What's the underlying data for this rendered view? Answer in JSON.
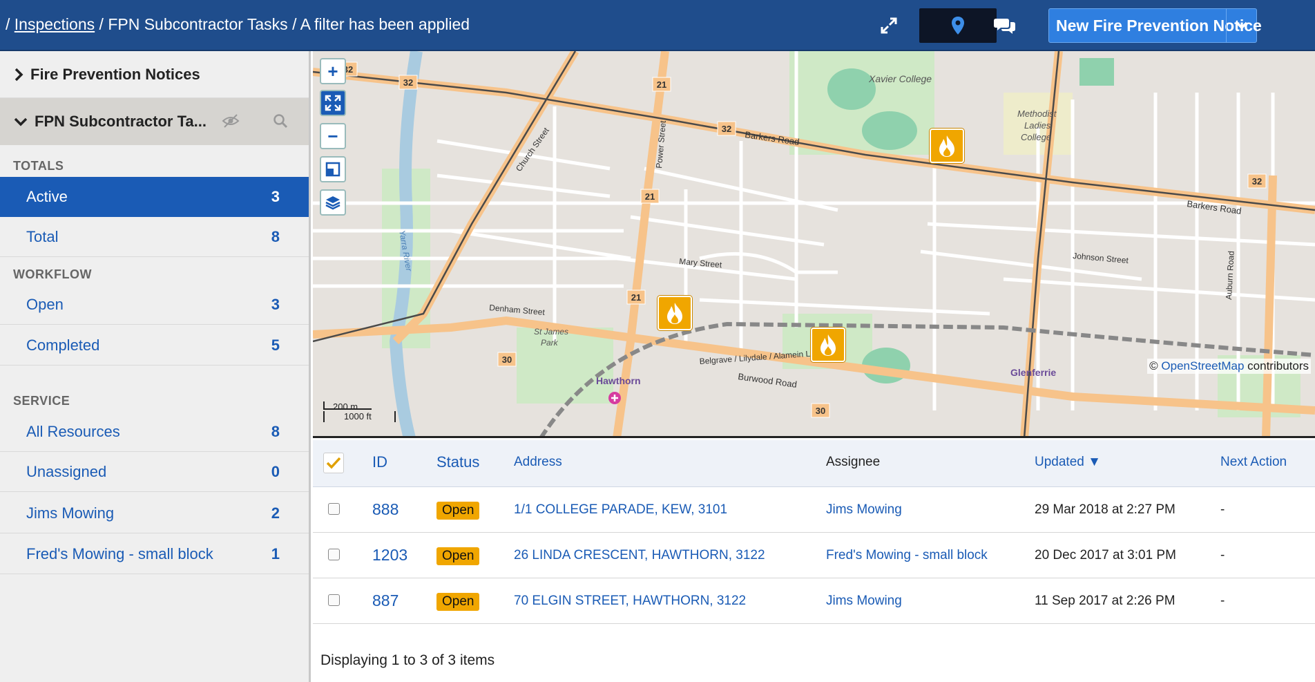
{
  "breadcrumb": {
    "prefix": "/",
    "link": "Inspections",
    "sep1": "/",
    "part2": "FPN Subcontractor Tasks",
    "sep2": "/",
    "part3": "A filter has been applied"
  },
  "toolbar": {
    "new_label": "New Fire Prevention Notice"
  },
  "sidebar": {
    "fpn_label": "Fire Prevention Notices",
    "sub_label": "FPN Subcontractor Ta...",
    "sections": {
      "totals": "TOTALS",
      "workflow": "WORKFLOW",
      "service": "SERVICE"
    },
    "totals": [
      {
        "label": "Active",
        "count": "3"
      },
      {
        "label": "Total",
        "count": "8"
      }
    ],
    "workflow": [
      {
        "label": "Open",
        "count": "3"
      },
      {
        "label": "Completed",
        "count": "5"
      }
    ],
    "service": [
      {
        "label": "All Resources",
        "count": "8"
      },
      {
        "label": "Unassigned",
        "count": "0"
      },
      {
        "label": "Jims Mowing",
        "count": "2"
      },
      {
        "label": "Fred's Mowing - small block",
        "count": "1"
      }
    ]
  },
  "map": {
    "attribution_prefix": "©",
    "attribution_link": "OpenStreetMap",
    "attribution_suffix": "contributors",
    "scale_m": "200 m",
    "scale_ft": "1000 ft",
    "labels": {
      "xavier": "Xavier College",
      "barkers": "Barkers Road",
      "barkers2": "Barkers Road",
      "burwood": "Burwood Road",
      "hawthorn": "Hawthorn",
      "glenferrie": "Glenferrie",
      "methodist": "Methodist",
      "ladies": "Ladies",
      "college": "College",
      "stjames": "St James",
      "park": "Park",
      "yarra": "Yarra River",
      "power": "Power Street",
      "church": "Church Street",
      "mary": "Mary Street",
      "denham": "Denham Street",
      "belgrave": "Belgrave / Lilydale / Alamein Line",
      "auburn": "Auburn Road",
      "johnson": "Johnson Street"
    },
    "route_numbers": [
      "32",
      "32",
      "32",
      "32",
      "21",
      "21",
      "21",
      "30",
      "30"
    ]
  },
  "table": {
    "headers": {
      "id": "ID",
      "status": "Status",
      "address": "Address",
      "assignee": "Assignee",
      "updated": "Updated ▼",
      "next": "Next Action"
    },
    "rows": [
      {
        "id": "888",
        "status": "Open",
        "address": "1/1 COLLEGE PARADE, KEW, 3101",
        "assignee": "Jims Mowing",
        "updated": "29 Mar 2018 at 2:27 PM",
        "next": "-"
      },
      {
        "id": "1203",
        "status": "Open",
        "address": "26 LINDA CRESCENT, HAWTHORN, 3122",
        "assignee": "Fred's Mowing - small block",
        "updated": "20 Dec 2017 at 3:01 PM",
        "next": "-"
      },
      {
        "id": "887",
        "status": "Open",
        "address": "70 ELGIN STREET, HAWTHORN, 3122",
        "assignee": "Jims Mowing",
        "updated": "11 Sep 2017 at 2:26 PM",
        "next": "-"
      }
    ],
    "footer": "Displaying 1 to 3 of 3 items"
  }
}
